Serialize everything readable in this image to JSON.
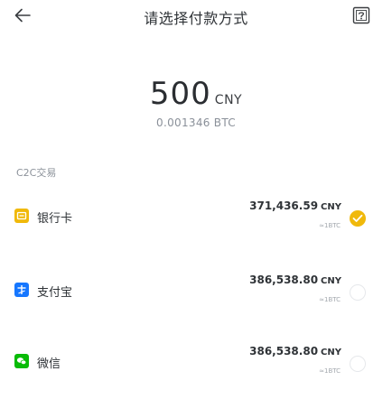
{
  "header": {
    "title": "请选择付款方式",
    "back_icon": "arrow-left-icon",
    "help_icon": "help-question-icon"
  },
  "amount": {
    "value": "500",
    "unit": "CNY",
    "btc_equivalent": "0.001346 BTC"
  },
  "section": {
    "label": "C2C交易"
  },
  "options": [
    {
      "name": "银行卡",
      "icon": "bank-card-icon",
      "icon_color": "#f0b90b",
      "price": "371,436.59",
      "unit": "CNY",
      "sub": "≈1BTC",
      "selected": true
    },
    {
      "name": "支付宝",
      "icon": "alipay-icon",
      "icon_color": "#1677ff",
      "price": "386,538.80",
      "unit": "CNY",
      "sub": "≈1BTC",
      "selected": false
    },
    {
      "name": "微信",
      "icon": "wechat-icon",
      "icon_color": "#09bb07",
      "price": "386,538.80",
      "unit": "CNY",
      "sub": "≈1BTC",
      "selected": false
    }
  ],
  "colors": {
    "accent": "#f0b90b",
    "text": "#2f3337",
    "muted": "#8c929a"
  }
}
